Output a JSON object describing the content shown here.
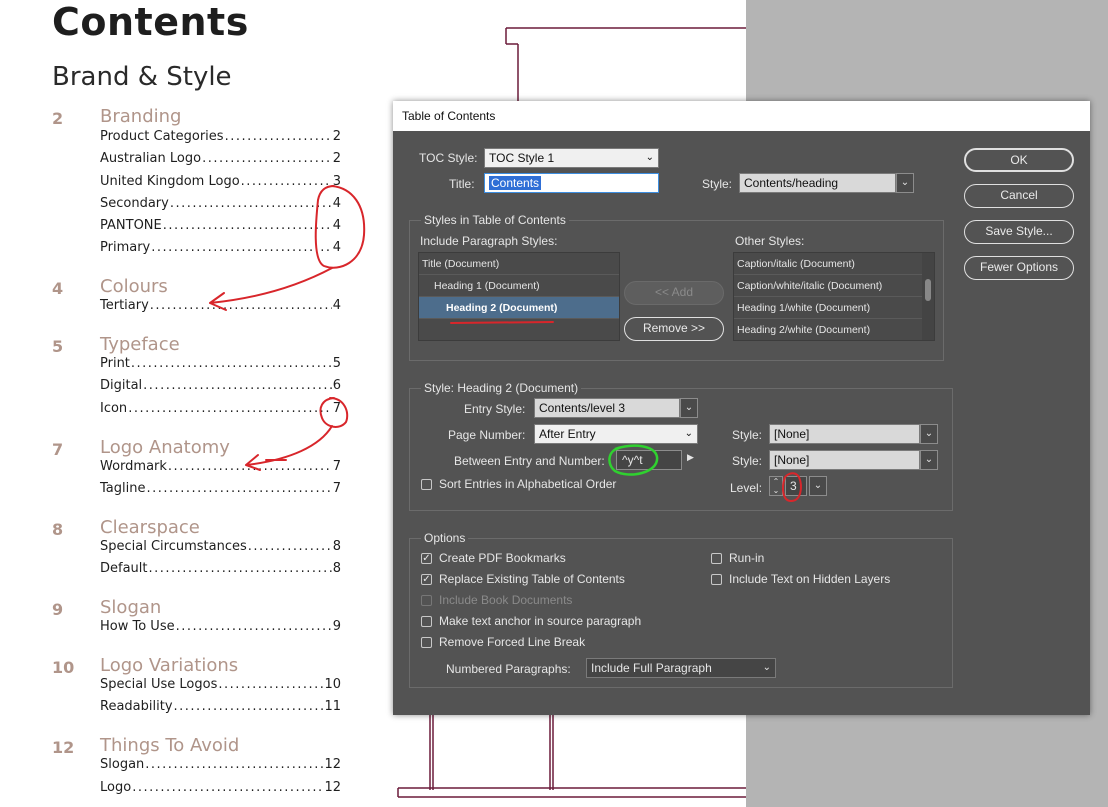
{
  "document": {
    "title": "Contents",
    "subtitle": "Brand & Style",
    "sections": [
      {
        "num": "2",
        "name": "Branding",
        "entries": [
          {
            "text": "Product Categories",
            "page": "2"
          },
          {
            "text": "Australian Logo",
            "page": "2"
          },
          {
            "text": "United Kingdom Logo",
            "page": "3"
          },
          {
            "text": "Secondary",
            "page": "4"
          },
          {
            "text": "PANTONE",
            "page": "4"
          },
          {
            "text": "Primary",
            "page": "4"
          }
        ]
      },
      {
        "num": "4",
        "name": "Colours",
        "entries": [
          {
            "text": "Tertiary",
            "page": "4"
          }
        ]
      },
      {
        "num": "5",
        "name": "Typeface",
        "entries": [
          {
            "text": "Print",
            "page": "5"
          },
          {
            "text": "Digital",
            "page": "6"
          },
          {
            "text": "Icon",
            "page": "7"
          }
        ]
      },
      {
        "num": "7",
        "name": "Logo Anatomy",
        "entries": [
          {
            "text": "Wordmark",
            "page": "7"
          },
          {
            "text": "Tagline",
            "page": "7"
          }
        ]
      },
      {
        "num": "8",
        "name": "Clearspace",
        "entries": [
          {
            "text": "Special Circumstances",
            "page": "8"
          },
          {
            "text": "Default",
            "page": "8"
          }
        ]
      },
      {
        "num": "9",
        "name": "Slogan",
        "entries": [
          {
            "text": "How To Use",
            "page": "9"
          }
        ]
      },
      {
        "num": "10",
        "name": "Logo Variations",
        "entries": [
          {
            "text": "Special Use Logos",
            "page": "10"
          },
          {
            "text": "Readability",
            "page": "11"
          }
        ]
      },
      {
        "num": "12",
        "name": "Things To Avoid",
        "entries": [
          {
            "text": "Slogan",
            "page": "12"
          },
          {
            "text": "Logo",
            "page": "12"
          }
        ]
      }
    ]
  },
  "dialog": {
    "title": "Table of Contents",
    "toc_style_label": "TOC Style:",
    "toc_style_value": "TOC Style 1",
    "title_label": "Title:",
    "title_value": "Contents",
    "style_label": "Style:",
    "title_style_value": "Contents/heading",
    "buttons": {
      "ok": "OK",
      "cancel": "Cancel",
      "save_style": "Save Style...",
      "fewer_options": "Fewer Options"
    },
    "styles_group": {
      "legend": "Styles in Table of Contents",
      "include_label": "Include Paragraph Styles:",
      "included": [
        "Title (Document)",
        "Heading 1 (Document)",
        "Heading 2 (Document)"
      ],
      "selected_index": 2,
      "add_label": "<< Add",
      "remove_label": "Remove >>",
      "other_label": "Other Styles:",
      "other": [
        "Caption/italic (Document)",
        "Caption/white/italic (Document)",
        "Heading 1/white (Document)",
        "Heading 2/white (Document)"
      ]
    },
    "style_group": {
      "legend": "Style: Heading 2 (Document)",
      "entry_style_label": "Entry Style:",
      "entry_style_value": "Contents/level 3",
      "page_number_label": "Page Number:",
      "page_number_value": "After Entry",
      "between_label": "Between Entry and Number:",
      "between_value": "^y^t",
      "style_label_1": "Style:",
      "style_value_1": "[None]",
      "style_label_2": "Style:",
      "style_value_2": "[None]",
      "sort_label": "Sort Entries in Alphabetical Order",
      "level_label": "Level:",
      "level_value": "3"
    },
    "options": {
      "legend": "Options",
      "create_pdf": "Create PDF Bookmarks",
      "replace_existing": "Replace Existing Table of Contents",
      "include_book": "Include Book Documents",
      "make_anchor": "Make text anchor in source paragraph",
      "remove_break": "Remove Forced Line Break",
      "run_in": "Run-in",
      "include_hidden": "Include Text on Hidden Layers",
      "numbered_label": "Numbered Paragraphs:",
      "numbered_value": "Include Full Paragraph",
      "checked": {
        "create_pdf": true,
        "replace_existing": true,
        "include_book": false,
        "make_anchor": false,
        "remove_break": false,
        "run_in": false,
        "include_hidden": false
      }
    }
  },
  "colors": {
    "dialog_bg": "#535353",
    "selection": "#4d6d8c",
    "heading_accent": "#b0958a",
    "annotation_red": "#d8262b",
    "annotation_green": "#2fd12f",
    "frame_edge": "#6b1b3a"
  }
}
